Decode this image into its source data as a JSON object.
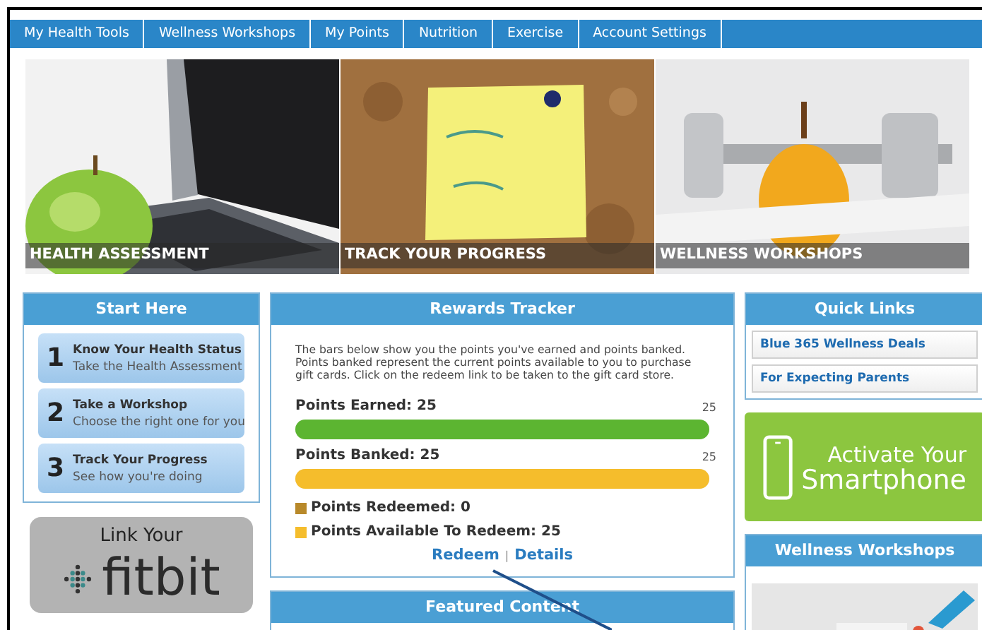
{
  "nav": [
    {
      "label": "My Health Tools"
    },
    {
      "label": "Wellness Workshops"
    },
    {
      "label": "My Points"
    },
    {
      "label": "Nutrition"
    },
    {
      "label": "Exercise"
    },
    {
      "label": "Account Settings"
    }
  ],
  "banners": [
    {
      "kind": "laptop",
      "caption": "HEALTH ASSESSMENT"
    },
    {
      "kind": "note",
      "caption": "TRACK YOUR PROGRESS"
    },
    {
      "kind": "dumbbell",
      "caption": "WELLNESS WORKSHOPS"
    }
  ],
  "start_here": {
    "title": "Start Here",
    "steps": [
      {
        "number": "1",
        "title": "Know Your Health Status",
        "subtitle": "Take the Health Assessment"
      },
      {
        "number": "2",
        "title": "Take a Workshop",
        "subtitle": "Choose the right one for you"
      },
      {
        "number": "3",
        "title": "Track Your Progress",
        "subtitle": "See how you're doing"
      }
    ]
  },
  "fitbit": {
    "caption": "Link Your",
    "logo": "fitbit"
  },
  "rewards": {
    "title": "Rewards Tracker",
    "intro": "The bars below show you the points you've earned and points banked. Points banked represent the current points available to you to purchase gift cards. Click on the redeem link to be taken to the gift card store.",
    "bars": [
      {
        "label": "Points Earned: 25",
        "max": "25",
        "level": 1,
        "color": "#5cb531"
      },
      {
        "label": "Points Banked: 25",
        "max": "25",
        "level": 1,
        "color": "#f5bd2c"
      }
    ],
    "legend": [
      {
        "label": "Points Redeemed: 0",
        "color": "#b8892a"
      },
      {
        "label": "Points Available To Redeem: 25",
        "color": "#f5bd2c"
      }
    ],
    "links": [
      "Redeem",
      "Details"
    ],
    "separator": "|"
  },
  "featured": {
    "title": "Featured Content"
  },
  "quick_links": {
    "title": "Quick Links",
    "items": [
      "Blue 365 Wellness Deals",
      "For Expecting Parents"
    ]
  },
  "smartphone": {
    "line1": "Activate Your",
    "line2": "Smartphone"
  },
  "workshops": {
    "title": "Wellness Workshops"
  }
}
